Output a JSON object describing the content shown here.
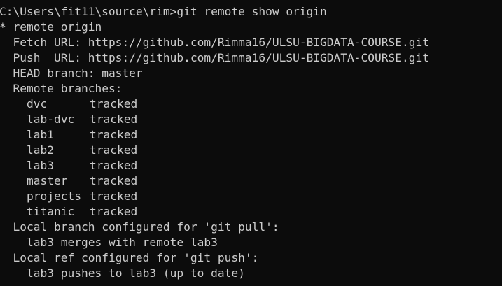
{
  "terminal": {
    "prompt": "C:\\Users\\fit11\\source\\rim>",
    "command": "git remote show origin",
    "remote_header": "* remote origin",
    "fetch_url": "Fetch URL: https://github.com/Rimma16/ULSU-BIGDATA-COURSE.git",
    "push_url": "Push  URL: https://github.com/Rimma16/ULSU-BIGDATA-COURSE.git",
    "head_branch": "HEAD branch: master",
    "remote_branches_header": "Remote branches:",
    "remote_branches": [
      {
        "name": "dvc",
        "status": "tracked"
      },
      {
        "name": "lab-dvc",
        "status": "tracked"
      },
      {
        "name": "lab1",
        "status": "tracked"
      },
      {
        "name": "lab2",
        "status": "tracked"
      },
      {
        "name": "lab3",
        "status": "tracked"
      },
      {
        "name": "master",
        "status": "tracked"
      },
      {
        "name": "projects",
        "status": "tracked"
      },
      {
        "name": "titanic",
        "status": "tracked"
      }
    ],
    "pull_config_header": "Local branch configured for 'git pull':",
    "pull_config_entry": "lab3 merges with remote lab3",
    "push_config_header": "Local ref configured for 'git push':",
    "push_config_entry": "lab3 pushes to lab3 (up to date)"
  }
}
